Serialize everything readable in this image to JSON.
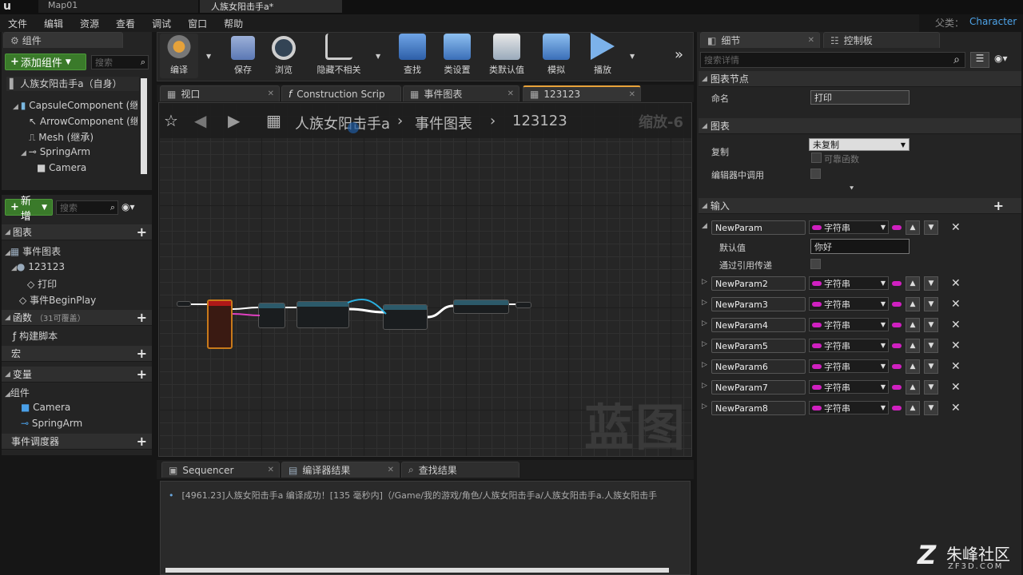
{
  "window": {
    "tabs": [
      "Map01",
      "人族女阳击手a*"
    ],
    "parent_label": "父类：",
    "parent_value": "Character"
  },
  "menu": [
    "文件",
    "编辑",
    "资源",
    "查看",
    "调试",
    "窗口",
    "帮助"
  ],
  "components_panel": {
    "tab": "组件",
    "add_button": "添加组件",
    "search_placeholder": "搜索",
    "root": "人族女阳击手a（自身）",
    "items": [
      "CapsuleComponent (继承)",
      "ArrowComponent (继承)",
      "Mesh (继承)",
      "SpringArm",
      "Camera"
    ]
  },
  "mybp_panel": {
    "new_button": "新增",
    "search_placeholder": "搜索",
    "graphs_header": "图表",
    "event_graph": "事件图表",
    "graph_123": "123123",
    "print": "打印",
    "begin_play": "事件BeginPlay",
    "functions_header": "函数",
    "functions_count": "（31可覆盖）",
    "construct_script": "构建脚本",
    "macros_header": "宏",
    "variables_header": "变量",
    "components_header": "组件",
    "var_camera": "Camera",
    "var_springarm": "SpringArm",
    "dispatchers_header": "事件调度器"
  },
  "toolbar": {
    "compile": "编译",
    "save": "保存",
    "browse": "浏览",
    "hide_unrelated": "隐藏不相关",
    "find": "查找",
    "class_settings": "类设置",
    "class_defaults": "类默认值",
    "simulate": "模拟",
    "play": "播放"
  },
  "editor_tabs": [
    "视口",
    "Construction Scrip",
    "事件图表",
    "123123"
  ],
  "breadcrumb": {
    "bp": "人族女阳击手a",
    "graph": "事件图表",
    "func": "123123",
    "zoom": "缩放-6"
  },
  "graph": {
    "watermark": "蓝图"
  },
  "bottom_panel": {
    "tabs": [
      "Sequencer",
      "编译器结果",
      "查找结果"
    ],
    "log": "[4961.23]人族女阳击手a 编译成功！[135 毫秒内]（/Game/我的游戏/角色/人族女阳击手a/人族女阳击手a.人族女阳击手"
  },
  "details": {
    "tabs": [
      "细节",
      "控制板"
    ],
    "search_placeholder": "搜索详情",
    "graph_node_header": "图表节点",
    "name_label": "命名",
    "name_value": "打印",
    "graph_header": "图表",
    "replicate_label": "复制",
    "replicate_value": "未复制",
    "reliable_label": "可靠函数",
    "call_in_editor_label": "编辑器中调用",
    "inputs_header": "输入",
    "default_label": "默认值",
    "default_value": "你好",
    "pass_by_ref_label": "通过引用传递",
    "type": "字符串",
    "params": [
      "NewParam",
      "NewParam2",
      "NewParam3",
      "NewParam4",
      "NewParam5",
      "NewParam6",
      "NewParam7",
      "NewParam8"
    ]
  },
  "logo": {
    "name": "朱峰社区",
    "site": "ZF3D.COM"
  }
}
